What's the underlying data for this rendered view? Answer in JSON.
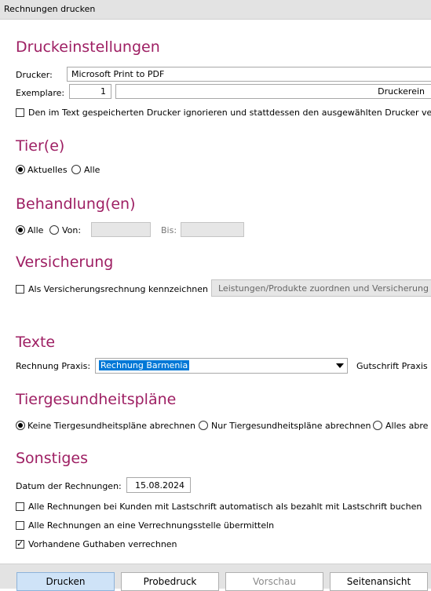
{
  "window": {
    "title": "Rechnungen drucken"
  },
  "druckeinstellungen": {
    "heading": "Druckeinstellungen",
    "drucker_label": "Drucker:",
    "drucker_value": "Microsoft Print to PDF",
    "exemplare_label": "Exemplare:",
    "exemplare_value": "1",
    "druckereinstellungen_label": "Druckerein",
    "ignore_label": "Den im Text gespeicherten Drucker ignorieren und stattdessen den ausgewählten Drucker ve",
    "ignore_checked": false
  },
  "tiere": {
    "heading": "Tier(e)",
    "aktuelles_label": "Aktuelles",
    "alle_label": "Alle",
    "selected": "Aktuelles"
  },
  "behandlungen": {
    "heading": "Behandlung(en)",
    "alle_label": "Alle",
    "von_label": "Von:",
    "bis_label": "Bis:",
    "von_value": "",
    "bis_value": "",
    "selected": "Alle"
  },
  "versicherung": {
    "heading": "Versicherung",
    "als_label": "Als Versicherungsrechnung kennzeichnen",
    "als_checked": false,
    "zuordnen_label": "Leistungen/Produkte zuordnen und Versicherung"
  },
  "texte": {
    "heading": "Texte",
    "rechnung_label": "Rechnung Praxis:",
    "rechnung_value": "Rechnung Barmenia",
    "gutschrift_label": "Gutschrift Praxis"
  },
  "tiergesundheitsplaene": {
    "heading": "Tiergesundheitspläne",
    "option1": "Keine Tiergesundheitspläne abrechnen",
    "option2": "Nur Tiergesundheitspläne abrechnen",
    "option3": "Alles abre",
    "selected": "option1"
  },
  "sonstiges": {
    "heading": "Sonstiges",
    "datum_label": "Datum der Rechnungen:",
    "datum_value": "15.08.2024",
    "cb1_label": "Alle Rechnungen bei Kunden mit Lastschrift automatisch als bezahlt mit Lastschrift buchen",
    "cb1_checked": false,
    "cb2_label": "Alle Rechnungen an eine Verrechnungsstelle übermitteln",
    "cb2_checked": false,
    "cb3_label": "Vorhandene Guthaben verrechnen",
    "cb3_checked": true
  },
  "footer": {
    "drucken": "Drucken",
    "probedruck": "Probedruck",
    "vorschau": "Vorschau",
    "seitenansicht": "Seitenansicht"
  }
}
